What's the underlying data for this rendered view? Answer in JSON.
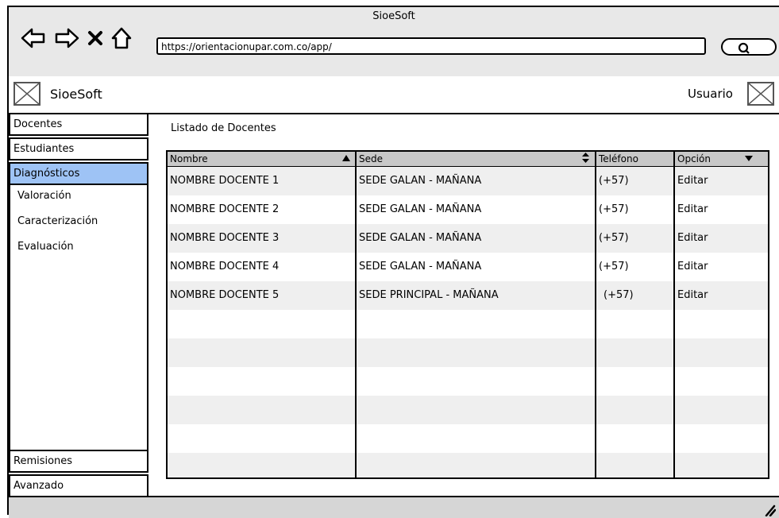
{
  "window": {
    "title": "SioeSoft"
  },
  "browser": {
    "url": "https://orientacionupar.com.co/app/"
  },
  "header": {
    "brand": "SioeSoft",
    "user_label": "Usuario"
  },
  "sidebar": {
    "items": [
      {
        "label": "Docentes"
      },
      {
        "label": "Estudiantes"
      },
      {
        "label": "Diagnósticos"
      }
    ],
    "subitems": [
      {
        "label": "Valoración"
      },
      {
        "label": "Caracterización"
      },
      {
        "label": "Evaluación"
      }
    ],
    "bottom": [
      {
        "label": "Remisiones"
      },
      {
        "label": "Avanzado"
      }
    ],
    "active_color": "#9ec3f5"
  },
  "main": {
    "title": "Listado de Docentes",
    "columns": [
      {
        "label": "Nombre"
      },
      {
        "label": "Sede"
      },
      {
        "label": "Teléfono"
      },
      {
        "label": "Opción"
      }
    ],
    "rows": [
      {
        "nombre": "NOMBRE DOCENTE 1",
        "sede": "SEDE GALAN - MAÑANA",
        "telefono": "(+57)",
        "opcion": "Editar"
      },
      {
        "nombre": "NOMBRE DOCENTE 2",
        "sede": "SEDE GALAN - MAÑANA",
        "telefono": "(+57)",
        "opcion": "Editar"
      },
      {
        "nombre": "NOMBRE DOCENTE 3",
        "sede": "SEDE GALAN - MAÑANA",
        "telefono": "(+57)",
        "opcion": "Editar"
      },
      {
        "nombre": "NOMBRE DOCENTE 4",
        "sede": "SEDE GALAN - MAÑANA",
        "telefono": "(+57)",
        "opcion": "Editar"
      },
      {
        "nombre": "NOMBRE DOCENTE 5",
        "sede": "SEDE PRINCIPAL - MAÑANA",
        "telefono": "(+57)",
        "opcion": "Editar"
      }
    ]
  }
}
